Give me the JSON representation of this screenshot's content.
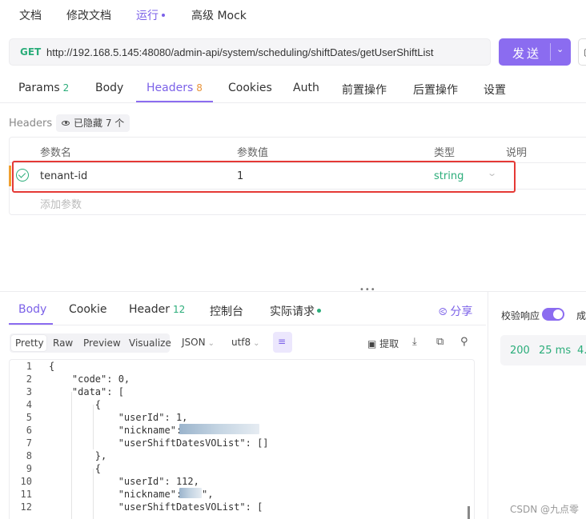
{
  "top_tabs": [
    {
      "label": "文档"
    },
    {
      "label": "修改文档"
    },
    {
      "label": "运行"
    },
    {
      "label": "高级 Mock"
    }
  ],
  "request": {
    "method": "GET",
    "url": "http://192.168.5.145:48080/admin-api/system/scheduling/shiftDates/getUserShiftList",
    "send_label": "发送"
  },
  "request_tabs": [
    {
      "label": "Params",
      "count": "2"
    },
    {
      "label": "Body"
    },
    {
      "label": "Headers",
      "count": "8"
    },
    {
      "label": "Cookies"
    },
    {
      "label": "Auth"
    },
    {
      "label": "前置操作"
    },
    {
      "label": "后置操作"
    },
    {
      "label": "设置"
    }
  ],
  "headers_section": {
    "title": "Headers",
    "hidden_label": "已隐藏 7 个",
    "columns": [
      "参数名",
      "参数值",
      "类型",
      "说明"
    ],
    "rows": [
      {
        "name": "tenant-id",
        "value": "1",
        "type": "string",
        "enabled": true
      }
    ],
    "add_param_placeholder": "添加参数"
  },
  "response_tabs": [
    {
      "label": "Body"
    },
    {
      "label": "Cookie"
    },
    {
      "label": "Header",
      "count": "12"
    },
    {
      "label": "控制台"
    },
    {
      "label": "实际请求"
    }
  ],
  "share_label": "分享",
  "viewer": {
    "modes": [
      "Pretty",
      "Raw",
      "Preview",
      "Visualize"
    ],
    "format": "JSON",
    "encoding": "utf8",
    "extract_label": "提取"
  },
  "code": {
    "line_numbers": [
      "1",
      "2",
      "3",
      "4",
      "5",
      "6",
      "7",
      "8",
      "9",
      "10",
      "11",
      "12"
    ],
    "lines": [
      "{",
      "    \"code\": 0,",
      "    \"data\": [",
      "        {",
      "            \"userId\": 1,",
      "            \"nickname\": \"",
      "            \"userShiftDatesVOList\": []",
      "        },",
      "        {",
      "            \"userId\": 112,",
      "            \"nickname\": \"",
      "            \"userShiftDatesVOList\": ["
    ],
    "line11_tail": "\","
  },
  "right_panel": {
    "verify_label": "校验响应",
    "verify_tail": "成",
    "status": "200",
    "time": "25 ms",
    "size": "4."
  },
  "watermark": "CSDN @九点零",
  "colors": {
    "accent": "#8b6cf0",
    "success": "#2bad7a",
    "highlight_box": "#e53935"
  }
}
